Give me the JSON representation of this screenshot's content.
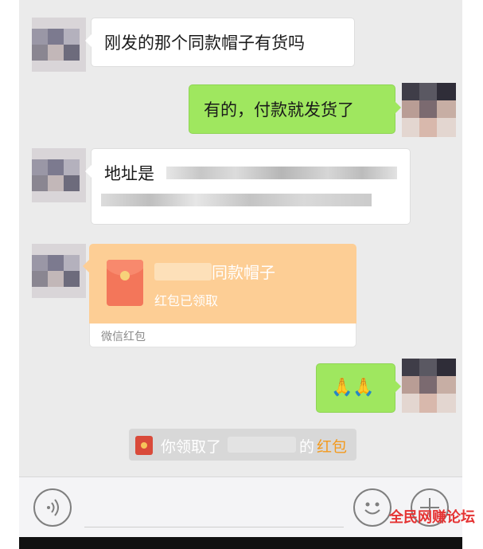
{
  "messages": {
    "m1_text": "刚发的那个同款帽子有货吗",
    "m2_text": "有的，付款就发货了",
    "m3_text": "地址是",
    "m5_emoji": "🙏🙏"
  },
  "red_packet": {
    "title": "同款帽子",
    "status": "红包已领取",
    "footer": "微信红包"
  },
  "system_notice": {
    "prefix": "你领取了",
    "middle": "的",
    "link": "红包"
  },
  "toolbar": {
    "voice_icon": "voice-icon",
    "emoji_icon": "emoji-icon",
    "plus_icon": "plus-icon"
  },
  "watermark": {
    "text": "全民网赚论坛"
  },
  "colors": {
    "chat_bg": "#ebebeb",
    "my_bubble": "#9fe75f",
    "red_packet": "#fdce95",
    "link_orange": "#f39a1e"
  }
}
